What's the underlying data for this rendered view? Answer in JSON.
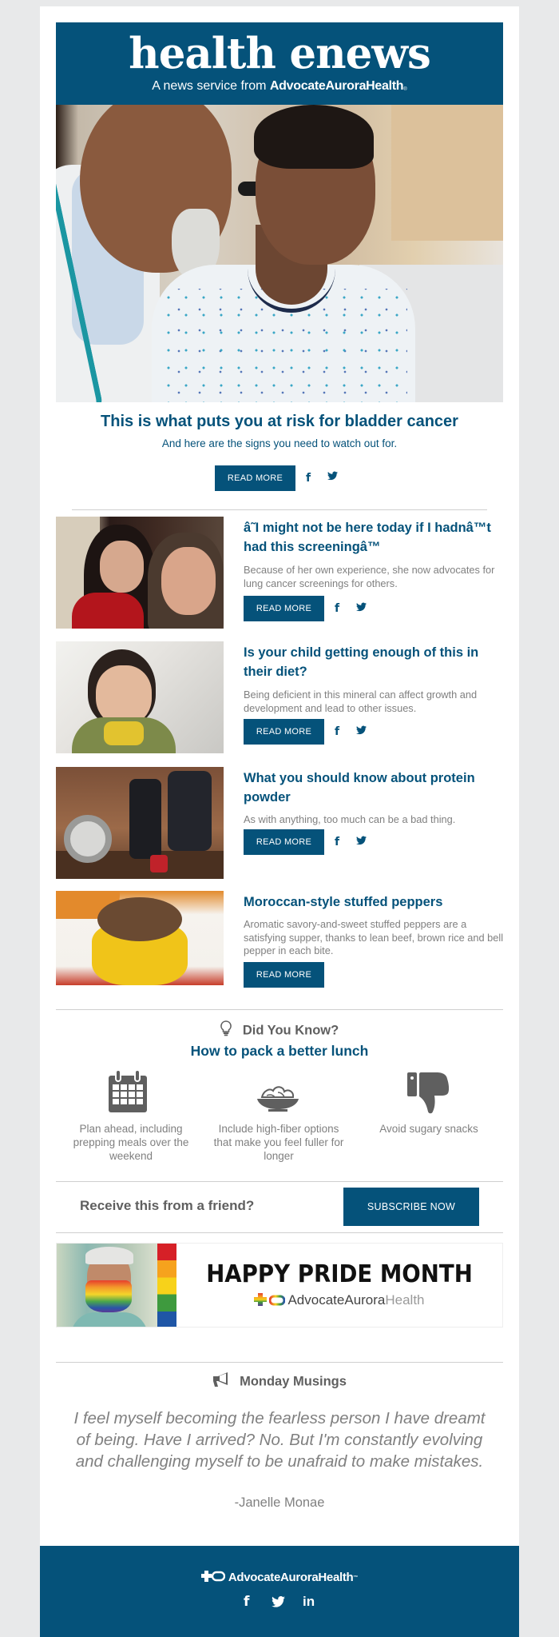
{
  "colors": {
    "brand_blue": "#05527a",
    "text_gray": "#808080",
    "heading_gray": "#5f5f5f",
    "page_bg": "#e8e9ea"
  },
  "header": {
    "title": "health enews",
    "subtitle_prefix": "A news service from ",
    "subtitle_brand": "AdvocateAuroraHealth",
    "trademark": "®"
  },
  "hero": {
    "image_alt": "Doctor examining patient's ear with an otoscope",
    "title": "This is what puts you at risk for bladder cancer",
    "subtitle": "And here are the signs you need to watch out for.",
    "read_more": "READ MORE",
    "facebook_icon": "f"
  },
  "articles": [
    {
      "image_alt": "Couple taking a selfie in a kitchen",
      "title": "â˜I might not be here today if I hadnâ™t had this screeningâ™",
      "description": "Because of her own experience, she now advocates for lung cancer screenings for others.",
      "read_more": "READ MORE",
      "has_social": true
    },
    {
      "image_alt": "Baby eating from a spoon",
      "title": "Is your child getting enough of this in their diet?",
      "description": "Being deficient in this mineral can affect growth and development and lead to other issues.",
      "read_more": "READ MORE",
      "has_social": true
    },
    {
      "image_alt": "Protein shaker bottles and dumbbells",
      "title": "What you should know about protein powder",
      "description": "As with anything, too much can be a bad thing.",
      "read_more": "READ MORE",
      "has_social": true
    },
    {
      "image_alt": "Yellow stuffed pepper on a plate",
      "title": "Moroccan-style stuffed peppers",
      "description": "Aromatic savory-and-sweet stuffed peppers are a satisfying supper, thanks to lean beef, brown rice and bell pepper in each bite.",
      "read_more": "READ MORE",
      "has_social": false
    }
  ],
  "social": {
    "facebook": "f",
    "linkedin": "in"
  },
  "did_you_know": {
    "heading": "Did You Know?",
    "subheading": "How to pack a better lunch",
    "tips": [
      {
        "icon": "calendar-icon",
        "text": "Plan ahead, including prepping meals over the weekend"
      },
      {
        "icon": "salad-bowl-icon",
        "text": "Include high-fiber options that make you feel fuller for longer"
      },
      {
        "icon": "thumbs-down-icon",
        "text": "Avoid sugary snacks"
      }
    ]
  },
  "subscribe": {
    "prompt": "Receive this from a friend?",
    "button": "SUBSCRIBE NOW"
  },
  "pride_banner": {
    "title": "HAPPY PRIDE MONTH",
    "brand_main": "AdvocateAurora",
    "brand_tail": "Health",
    "image_alt": "Woman wearing a rainbow face mask"
  },
  "monday_musings": {
    "heading": "Monday Musings",
    "quote": "I feel myself becoming the fearless person I have dreamt of being. Have I arrived? No. But I'm constantly evolving and challenging myself to be unafraid to make mistakes.",
    "author": "-Janelle Monae"
  },
  "footer": {
    "brand": "AdvocateAuroraHealth",
    "trademark": "™"
  }
}
